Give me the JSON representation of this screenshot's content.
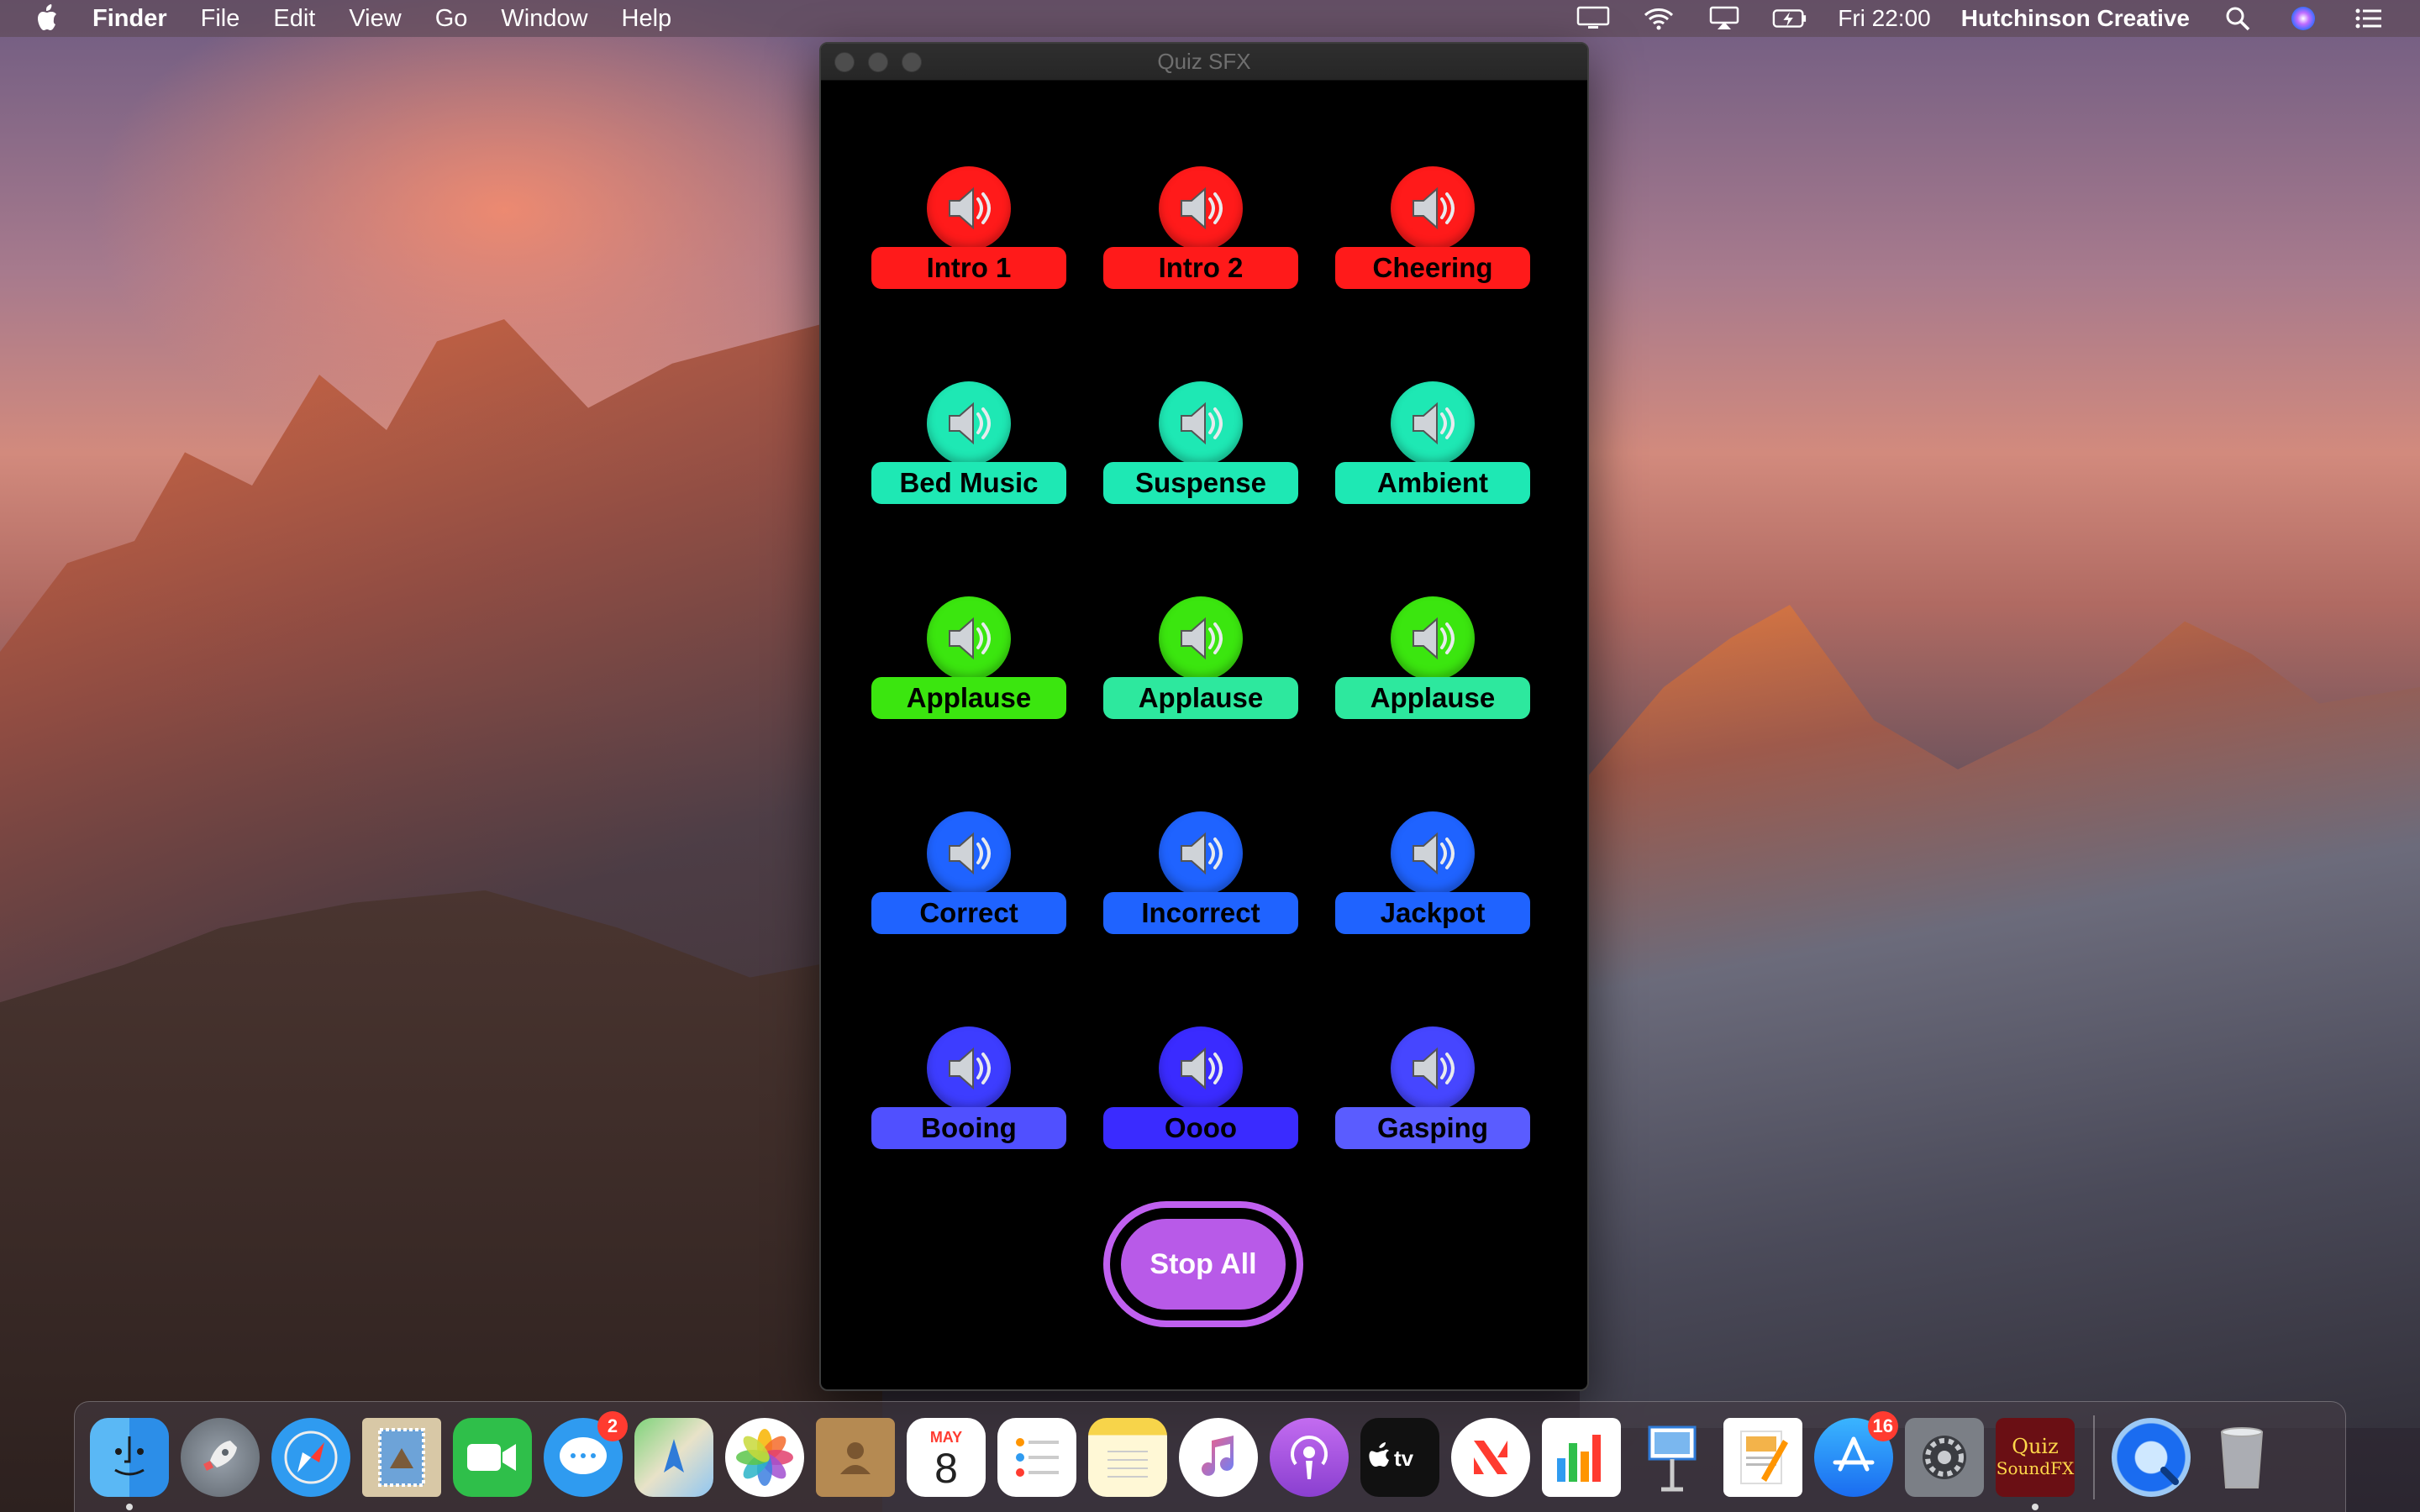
{
  "menubar": {
    "app_name": "Finder",
    "menus": [
      "File",
      "Edit",
      "View",
      "Go",
      "Window",
      "Help"
    ],
    "clock": "Fri 22:00",
    "user": "Hutchinson Creative"
  },
  "window": {
    "title": "Quiz SFX",
    "buttons": [
      {
        "label": "Intro 1",
        "color": "#ff1a1a"
      },
      {
        "label": "Intro 2",
        "color": "#ff1a1a"
      },
      {
        "label": "Cheering",
        "color": "#ff1a1a"
      },
      {
        "label": "Bed Music",
        "color": "#1ee8b4"
      },
      {
        "label": "Suspense",
        "color": "#1ee8b4"
      },
      {
        "label": "Ambient",
        "color": "#1ee8b4"
      },
      {
        "label": "Applause",
        "color": "#3be60f"
      },
      {
        "label": "Applause",
        "color": "#2de89e"
      },
      {
        "label": "Applause",
        "color": "#2de89e"
      },
      {
        "label": "Correct",
        "color": "#1f63ff"
      },
      {
        "label": "Incorrect",
        "color": "#1f63ff"
      },
      {
        "label": "Jackpot",
        "color": "#1f63ff"
      },
      {
        "label": "Booing",
        "color": "#5050ff"
      },
      {
        "label": "Oooo",
        "color": "#3a2bff"
      },
      {
        "label": "Gasping",
        "color": "#5a5cff"
      }
    ],
    "stop_all_label": "Stop All",
    "stop_all_color": "#b85ae8"
  },
  "dock": {
    "apps": [
      {
        "name": "Finder",
        "icon": "finder-icon"
      },
      {
        "name": "Launchpad",
        "icon": "rocket-icon"
      },
      {
        "name": "Safari",
        "icon": "compass-icon"
      },
      {
        "name": "Mail",
        "icon": "stamp-icon"
      },
      {
        "name": "FaceTime",
        "icon": "video-icon"
      },
      {
        "name": "Messages",
        "icon": "chat-bubble-icon",
        "badge": "2"
      },
      {
        "name": "Maps",
        "icon": "map-icon"
      },
      {
        "name": "Photos",
        "icon": "photos-icon"
      },
      {
        "name": "Contacts",
        "icon": "contacts-icon"
      },
      {
        "name": "Calendar",
        "icon": "calendar-icon",
        "month": "MAY",
        "day": "8"
      },
      {
        "name": "Reminders",
        "icon": "reminders-icon"
      },
      {
        "name": "Notes",
        "icon": "notes-icon"
      },
      {
        "name": "Music",
        "icon": "music-note-icon"
      },
      {
        "name": "Podcasts",
        "icon": "podcast-icon"
      },
      {
        "name": "TV",
        "icon": "tv-icon",
        "label": "tv"
      },
      {
        "name": "News",
        "icon": "news-icon"
      },
      {
        "name": "Numbers",
        "icon": "bar-chart-icon"
      },
      {
        "name": "Keynote",
        "icon": "keynote-icon"
      },
      {
        "name": "Pages",
        "icon": "pages-icon"
      },
      {
        "name": "App Store",
        "icon": "app-store-icon",
        "badge": "16"
      },
      {
        "name": "System Preferences",
        "icon": "gear-icon"
      },
      {
        "name": "Quiz SoundFX",
        "icon": "quiz-soundfx-icon",
        "label_top": "Quiz",
        "label_bottom": "SoundFX"
      }
    ],
    "extras": [
      {
        "name": "QuickTime",
        "icon": "quicktime-icon"
      },
      {
        "name": "Trash",
        "icon": "trash-icon"
      }
    ]
  }
}
